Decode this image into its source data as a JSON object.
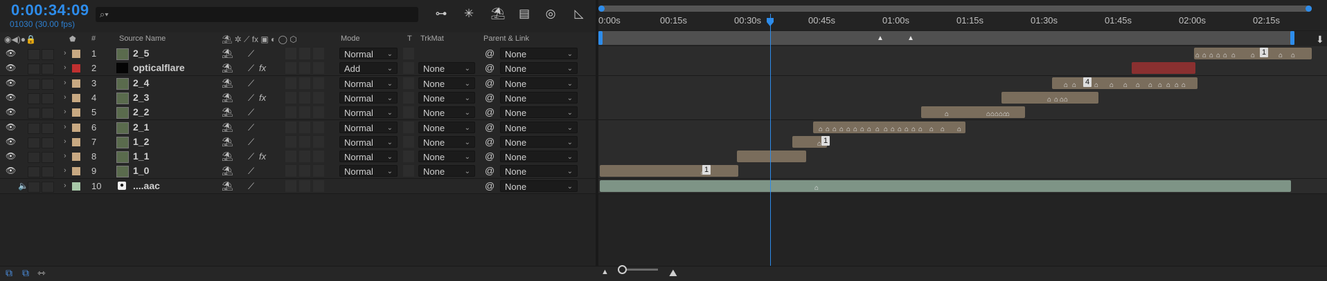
{
  "header": {
    "timecode": "0:00:34:09",
    "fps_label": "01030 (30.00 fps)",
    "search_placeholder": ""
  },
  "columns": {
    "source_name": "Source Name",
    "mode": "Mode",
    "t": "T",
    "trkmat": "TrkMat",
    "parent_link": "Parent & Link"
  },
  "ruler": {
    "ticks": [
      "0:00s",
      "00:15s",
      "00:30s",
      "00:45s",
      "01:00s",
      "01:15s",
      "01:30s",
      "01:45s",
      "02:00s",
      "02:15s"
    ]
  },
  "layers": [
    {
      "num": "1",
      "name": "2_5",
      "label_color": "#c8a982",
      "mode": "Normal",
      "trkmat": "",
      "parent": "None",
      "fx": false,
      "video": true,
      "audio": false
    },
    {
      "num": "2",
      "name": "opticalflare",
      "label_color": "#c03030",
      "mode": "Add",
      "trkmat": "None",
      "parent": "None",
      "fx": true,
      "video": true,
      "audio": false
    },
    {
      "num": "3",
      "name": "2_4",
      "label_color": "#c8a982",
      "mode": "Normal",
      "trkmat": "None",
      "parent": "None",
      "fx": false,
      "video": true,
      "audio": false
    },
    {
      "num": "4",
      "name": "2_3",
      "label_color": "#c8a982",
      "mode": "Normal",
      "trkmat": "None",
      "parent": "None",
      "fx": true,
      "video": true,
      "audio": false
    },
    {
      "num": "5",
      "name": "2_2",
      "label_color": "#c8a982",
      "mode": "Normal",
      "trkmat": "None",
      "parent": "None",
      "fx": false,
      "video": true,
      "audio": false
    },
    {
      "num": "6",
      "name": "2_1",
      "label_color": "#c8a982",
      "mode": "Normal",
      "trkmat": "None",
      "parent": "None",
      "fx": false,
      "video": true,
      "audio": false
    },
    {
      "num": "7",
      "name": "1_2",
      "label_color": "#c8a982",
      "mode": "Normal",
      "trkmat": "None",
      "parent": "None",
      "fx": false,
      "video": true,
      "audio": false
    },
    {
      "num": "8",
      "name": "1_1",
      "label_color": "#c8a982",
      "mode": "Normal",
      "trkmat": "None",
      "parent": "None",
      "fx": true,
      "video": true,
      "audio": false
    },
    {
      "num": "9",
      "name": "1_0",
      "label_color": "#c8a982",
      "mode": "Normal",
      "trkmat": "None",
      "parent": "None",
      "fx": false,
      "video": true,
      "audio": false
    },
    {
      "num": "10",
      "name": "....aac",
      "label_color": "#a8c8a8",
      "mode": "",
      "trkmat": "",
      "parent": "None",
      "fx": false,
      "video": false,
      "audio": true
    }
  ],
  "markers": {
    "layer1": "1",
    "layer3": "4",
    "layer7": "1",
    "layer9": "1"
  },
  "colors": {
    "accent": "#2d8ceb",
    "clip_tan": "#7a6d5c",
    "clip_red": "#8a3030",
    "clip_audio": "#7e9486"
  }
}
